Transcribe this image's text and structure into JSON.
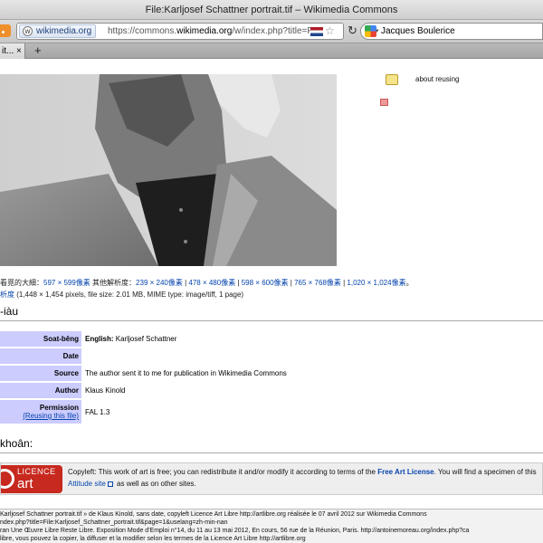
{
  "window": {
    "title": "File:Karljosef Schattner portrait.tif – Wikimedia Commons"
  },
  "toolbar": {
    "site_chip": "wikimedia.org",
    "url_prefix": "https://commons.",
    "url_domain": "wikimedia.org",
    "url_rest": "/w/index.php?title=File:Karljosef_Schattner_portrait.tif",
    "search_value": "Jacques Boulerice"
  },
  "tabs": {
    "current_label": "it...",
    "close_glyph": "×",
    "new_tab_glyph": "+"
  },
  "sidebar": {
    "reuse_link": "about reusing"
  },
  "file_info": {
    "resolution_label": "看覓的大細：",
    "preview_size": "597 × 599像素",
    "other_res_label": " 其他解析度：",
    "resolutions": [
      "239 × 240像素",
      "478 × 480像素",
      "598 × 600像素",
      "765 × 768像素",
      "1,020 × 1,024像素"
    ],
    "end_mark": "。",
    "original_link": "析度",
    "original_details": " (1,448 × 1,454 pixels, file size: 2.01 MB, MIME type: image/tiff, 1 page)"
  },
  "summary": {
    "heading": "-iàu",
    "rows": [
      {
        "label": "Soat-bêng",
        "value_bold": "English:",
        "value": " Karljosef Schattner"
      },
      {
        "label": "Date",
        "value_bold": "",
        "value": ""
      },
      {
        "label": "Source",
        "value_bold": "",
        "value": "The author sent it to me for publication in Wikimedia Commons"
      },
      {
        "label": "Author",
        "value_bold": "",
        "value": "Klaus Kinold"
      }
    ],
    "permission_label": "Permission",
    "permission_sub": "(Reusing this file)",
    "permission_value": "FAL 1.3"
  },
  "licensing": {
    "heading": "khoân:",
    "logo_top": "LICENCE",
    "logo_bottom": "art libre",
    "text_before": "Copyleft: This work of art is free; you can redistribute it and/or modify it according to terms of the ",
    "link": "Free Art License",
    "text_after": ". You will find a specimen of this",
    "line2_link": "Attitude site",
    "line2_rest": " as well as on other sites."
  },
  "footer": {
    "lines": [
      "Karljosef Schattner portrait.tif » de Klaus Kinold, sans date, copyleft Licence Art Libre http://artlibre.org réalisée le 07 avril 2012 sur Wikimedia Commons",
      "ndex.php?title=File:Karljosef_Schattner_portrait.tif&page=1&uselang=zh-min-nan",
      "ran Une Œuvre Libre Reste Libre. Exposition Mode d'Emploi n°14, du 11 au 13 mai 2012, En cours, 56 rue de la Réunion, Paris. http://antoinemoreau.org/index.php?ca",
      "libre, vous pouvez la copier, la diffuser et la modifier selon les termes de la Licence Art Libre http://artlibre.org"
    ]
  },
  "colors": {
    "table_header_bg": "#ccccff",
    "link": "#0645ad",
    "licence_red": "#c7291f"
  },
  "icons": {
    "rss": "rss-icon",
    "site": "wikimedia-icon",
    "star": "bookmark-star-icon",
    "reload": "reload-icon",
    "search_engine": "google-icon",
    "reuse": "reuse-icon",
    "flag": "flag-icon"
  }
}
